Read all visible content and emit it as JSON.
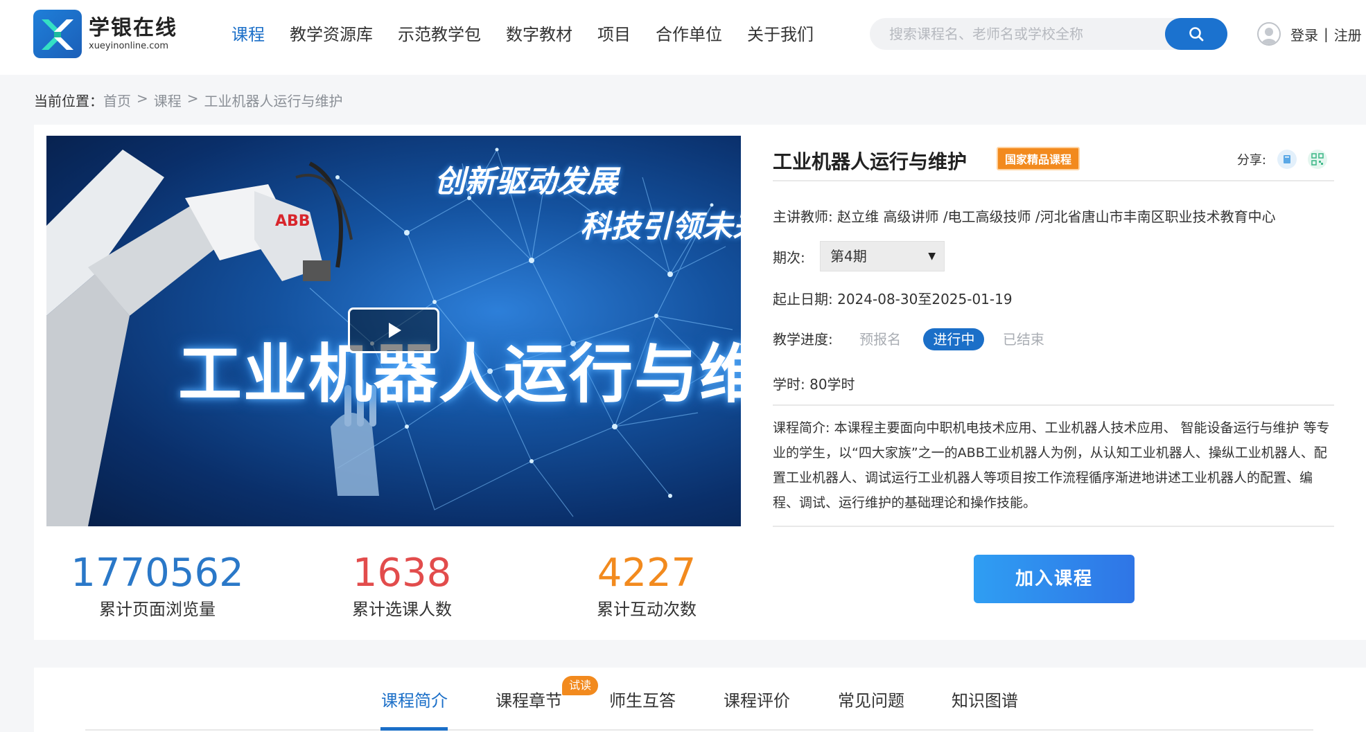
{
  "brand": {
    "name_cn": "学银在线",
    "name_en": "xueyinonline.com"
  },
  "nav": {
    "items": [
      "课程",
      "教学资源库",
      "示范教学包",
      "数字教材",
      "项目",
      "合作单位",
      "关于我们"
    ],
    "active_index": 0
  },
  "search": {
    "placeholder": "搜索课程名、老师名或学校全称"
  },
  "user": {
    "login": "登录",
    "separator": "|",
    "register": "注册"
  },
  "breadcrumb": {
    "label": "当前位置：",
    "items": [
      "首页",
      "课程",
      "工业机器人运行与维护"
    ],
    "separator": ">"
  },
  "video": {
    "title_text": "工业机器人运行与维护",
    "slogan_1": "创新驱动发展",
    "slogan_2": "科技引领未来",
    "robot_brand": "ABB"
  },
  "stats": [
    {
      "value": "1770562",
      "label": "累计页面浏览量",
      "color": "#2a78c8"
    },
    {
      "value": "1638",
      "label": "累计选课人数",
      "color": "#e24c4c"
    },
    {
      "value": "4227",
      "label": "累计互动次数",
      "color": "#f28a1e"
    }
  ],
  "course": {
    "title": "工业机器人运行与维护",
    "badge": "国家精品课程",
    "share_label": "分享:",
    "teacher_label": "主讲教师:",
    "teacher": "赵立维 高级讲师 /电工高级技师 /河北省唐山市丰南区职业技术教育中心",
    "period_label": "期次:",
    "period_value": "第4期",
    "date_label": "起止日期:",
    "date_value": "2024-08-30至2025-01-19",
    "progress_label": "教学进度:",
    "progress_states": [
      "预报名",
      "进行中",
      "已结束"
    ],
    "progress_active_index": 1,
    "hours_label": "学时:",
    "hours_value": "80学时",
    "intro_label": "课程简介:",
    "intro": "本课程主要面向中职机电技术应用、工业机器人技术应用、 智能设备运行与维护 等专业的学生，以“四大家族”之一的ABB工业机器人为例，从认知工业机器人、操纵工业机器人、配置工业机器人、调试运行工业机器人等项目按工作流程循序渐进地讲述工业机器人的配置、编程、调试、运行维护的基础理论和操作技能。",
    "join_button": "加入课程"
  },
  "tabs": {
    "items": [
      "课程简介",
      "课程章节",
      "师生互答",
      "课程评价",
      "常见问题",
      "知识图谱"
    ],
    "active_index": 0,
    "trial_badge": "试读"
  },
  "colors": {
    "accent": "#1b6fc8",
    "orange": "#f28a1e",
    "red": "#e24c4c"
  }
}
